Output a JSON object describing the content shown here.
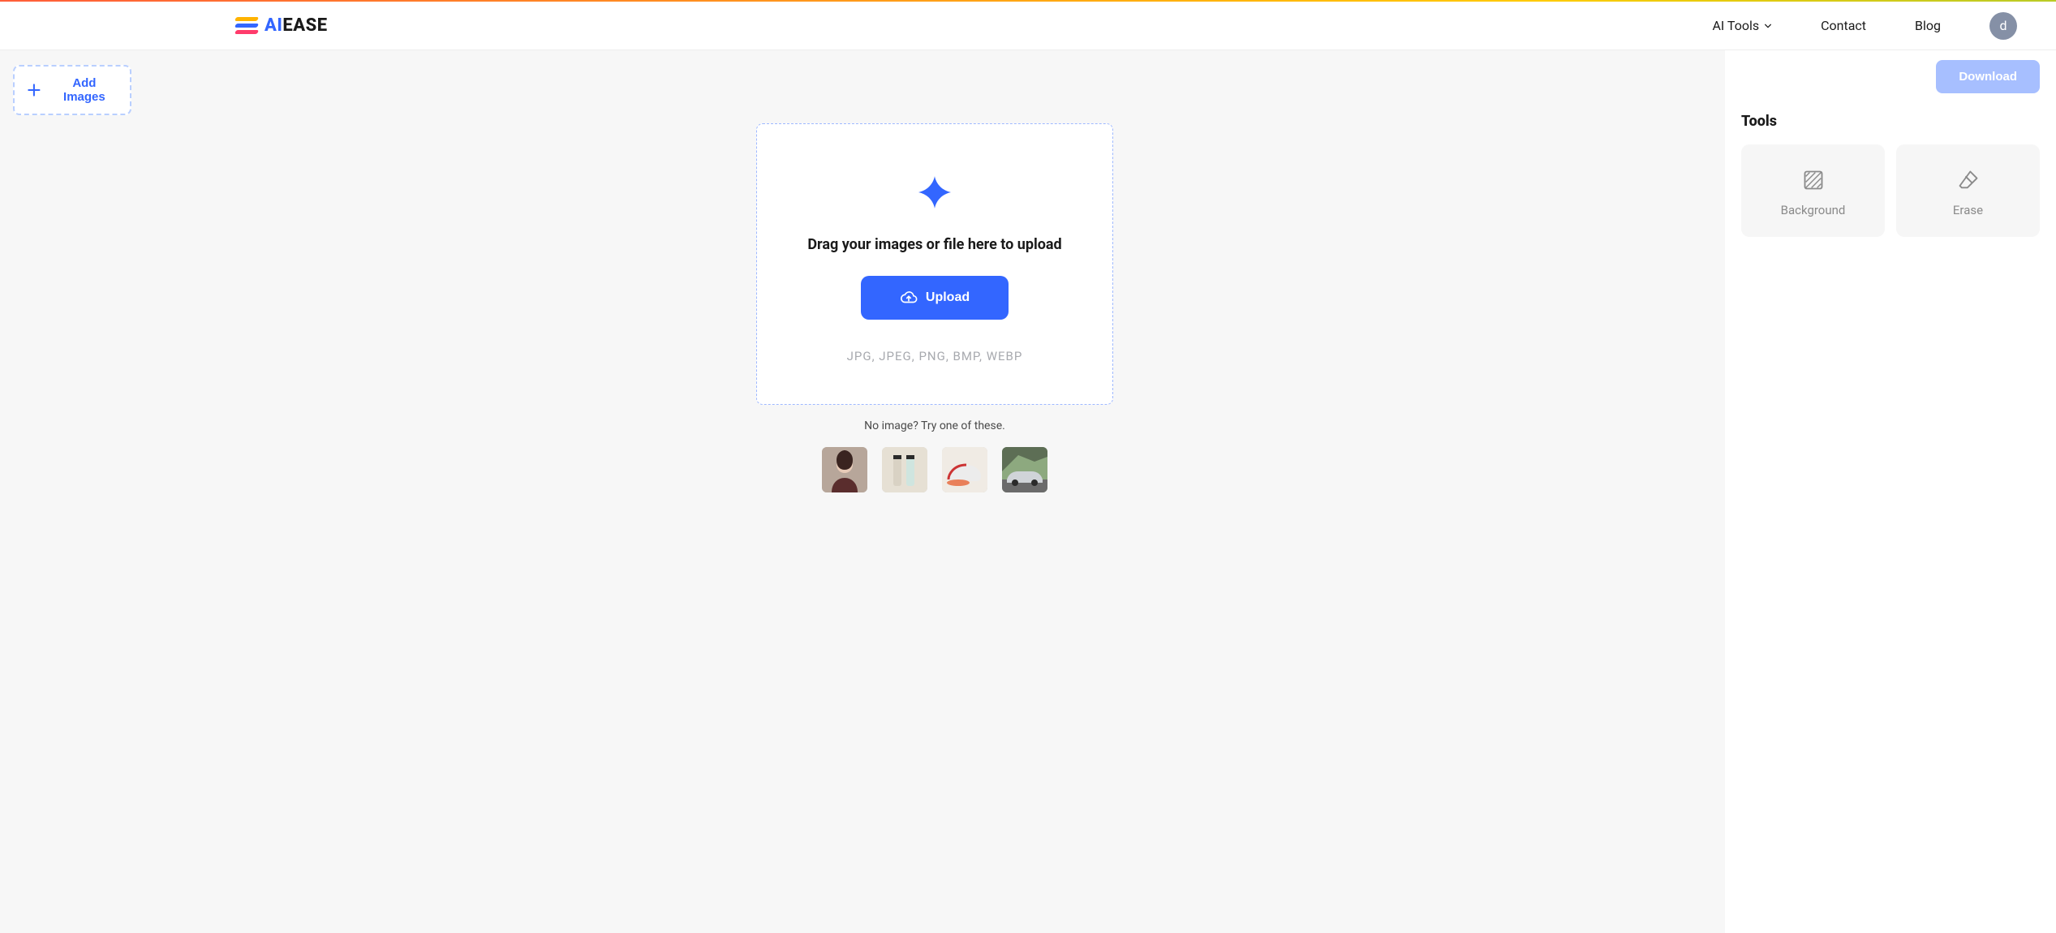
{
  "brand": {
    "ai": "AI",
    "ease": "EASE"
  },
  "nav": {
    "ai_tools": "AI Tools",
    "contact": "Contact",
    "blog": "Blog",
    "avatar_letter": "d"
  },
  "left": {
    "add_images": "Add Images"
  },
  "drop": {
    "title": "Drag your images or file here to upload",
    "upload": "Upload",
    "formats": "JPG,  JPEG,  PNG,  BMP,  WEBP"
  },
  "samples": {
    "prompt": "No image? Try one of these.",
    "items": [
      "person-sample",
      "bottles-sample",
      "shoe-sample",
      "car-sample"
    ]
  },
  "right": {
    "download": "Download",
    "tools_title": "Tools",
    "tool_background": "Background",
    "tool_erase": "Erase"
  }
}
